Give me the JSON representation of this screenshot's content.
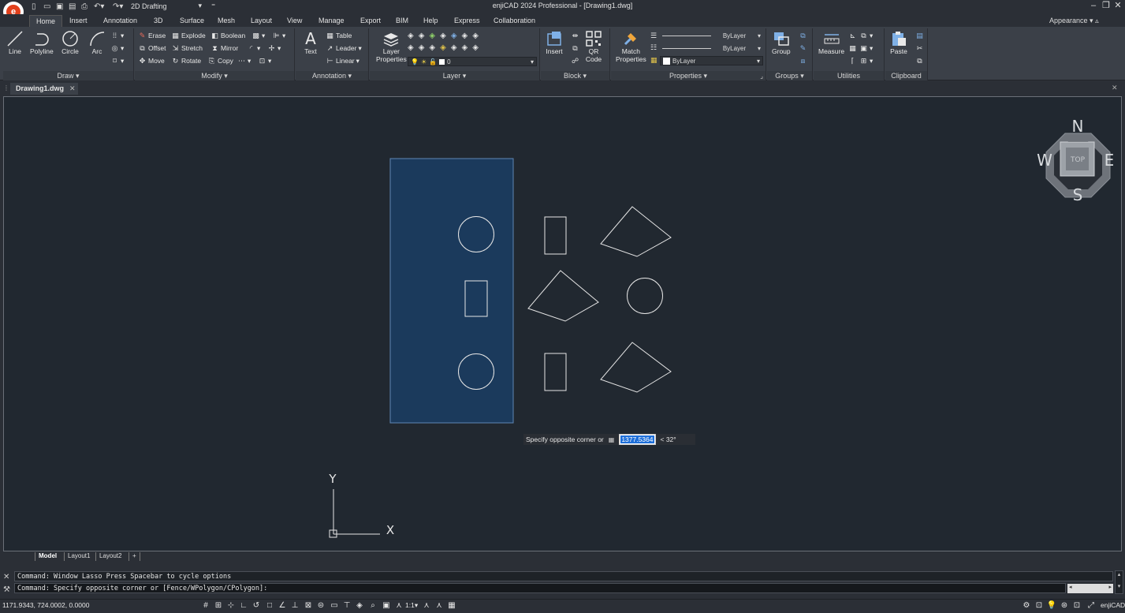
{
  "window": {
    "title": "enjiCAD 2024 Professional - [Drawing1.dwg]",
    "workspace": "2D Drafting",
    "appearance_label": "Appearance"
  },
  "menu_tabs": [
    "Home",
    "Insert",
    "Annotation",
    "3D",
    "Surface",
    "Mesh",
    "Layout",
    "View",
    "Manage",
    "Export",
    "BIM",
    "Help",
    "Express",
    "Collaboration"
  ],
  "ribbon": {
    "draw": {
      "title": "Draw",
      "line": "Line",
      "polyline": "Polyline",
      "circle": "Circle",
      "arc": "Arc"
    },
    "modify": {
      "title": "Modify",
      "erase": "Erase",
      "explode": "Explode",
      "boolean": "Boolean",
      "offset": "Offset",
      "stretch": "Stretch",
      "mirror": "Mirror",
      "move": "Move",
      "rotate": "Rotate",
      "copy": "Copy"
    },
    "annotation": {
      "title": "Annotation",
      "text": "Text",
      "table": "Table",
      "leader": "Leader",
      "linear": "Linear"
    },
    "layer": {
      "title": "Layer",
      "layer_properties_1": "Layer",
      "layer_properties_2": "Properties",
      "current_layer": "0"
    },
    "block": {
      "title": "Block",
      "insert": "Insert",
      "qr_1": "QR",
      "qr_2": "Code"
    },
    "properties": {
      "title": "Properties",
      "match_1": "Match",
      "match_2": "Properties",
      "linetype": "ByLayer",
      "lineweight": "ByLayer",
      "color": "ByLayer"
    },
    "groups": {
      "title": "Groups",
      "group": "Group"
    },
    "utilities": {
      "title": "Utilities",
      "measure": "Measure"
    },
    "clipboard": {
      "title": "Clipboard",
      "paste": "Paste"
    }
  },
  "document_tab": "Drawing1.dwg",
  "viewcube": {
    "top": "TOP",
    "north": "N",
    "south": "S",
    "east": "E",
    "west": "W"
  },
  "dynamic_input": {
    "prompt": "Specify opposite corner or",
    "value": "1377.5364",
    "angle": "< 32°"
  },
  "ucs": {
    "x_label": "X",
    "y_label": "Y"
  },
  "layout_tabs": [
    "Model",
    "Layout1",
    "Layout2",
    "+"
  ],
  "command_history": [
    "Command: Window Lasso  Press Spacebar to cycle options",
    "Command: Specify opposite corner or [Fence/WPolygon/CPolygon]:"
  ],
  "status": {
    "coordinates": "1171.9343, 724.0002, 0.0000",
    "scale": "1:1",
    "brand": "enjiCAD"
  },
  "colors": {
    "canvas_bg": "#212830",
    "selection_fill": "#1b3a5c",
    "selection_border": "#5f86b3",
    "entity": "#e6e6e6",
    "accent": "#e2401c"
  }
}
